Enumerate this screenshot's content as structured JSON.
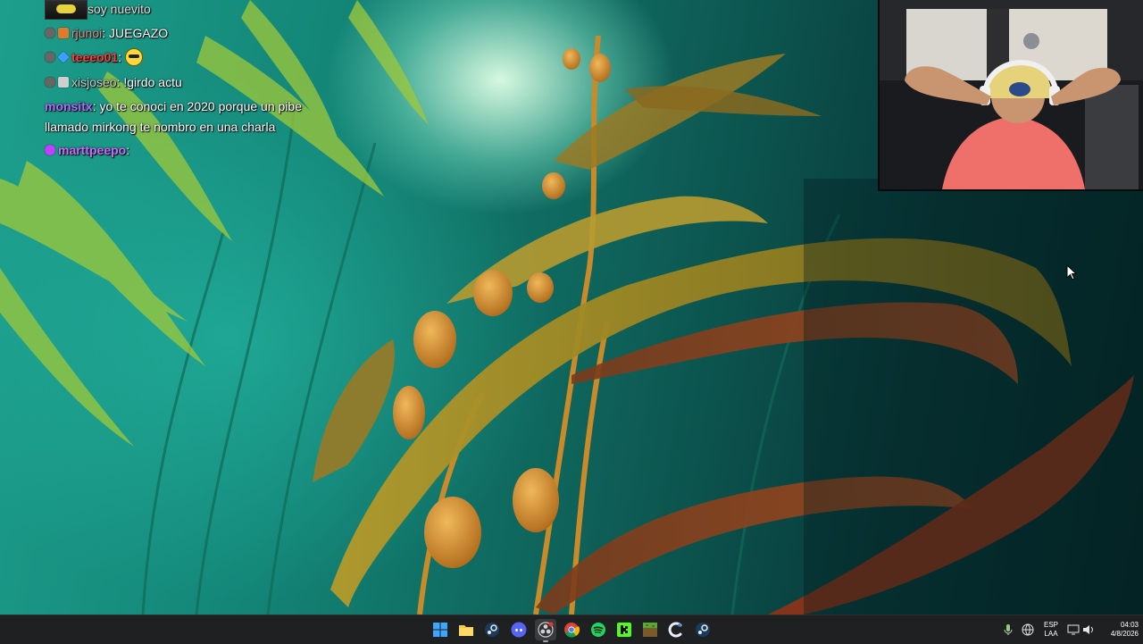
{
  "chat": {
    "messages": [
      {
        "user": "",
        "text": "soy nuevito",
        "user_color": "#dddddd",
        "has_thumbnail": true
      },
      {
        "user": "rjunoi",
        "text": ": JUEGAZO",
        "user_color": "#e08a8a"
      },
      {
        "user": "teeeo01",
        "text": ":",
        "user_color": "#ff3b3b",
        "has_emote": true
      },
      {
        "user": "xisjoseo",
        "text": ": !girdo actu",
        "user_color": "#c9c9c9"
      },
      {
        "user": "monsitx",
        "text": ": yo te conoci en 2020 porque un pibe",
        "user_color": "#b06bff"
      },
      {
        "user": "",
        "text": "llamado mirkong te nombro en una charla",
        "user_color": "#ffffff"
      },
      {
        "user": "marttpeepo",
        "text": ":",
        "user_color": "#c86bff"
      }
    ]
  },
  "taskbar": {
    "apps": [
      {
        "name": "start",
        "label": "Start"
      },
      {
        "name": "file-explorer",
        "label": "File Explorer"
      },
      {
        "name": "steam",
        "label": "Steam"
      },
      {
        "name": "discord",
        "label": "Discord"
      },
      {
        "name": "obs",
        "label": "OBS"
      },
      {
        "name": "chrome",
        "label": "Chrome"
      },
      {
        "name": "spotify",
        "label": "Spotify"
      },
      {
        "name": "kick",
        "label": "Kick"
      },
      {
        "name": "minecraft",
        "label": "Minecraft"
      },
      {
        "name": "ccleaner",
        "label": "CCleaner"
      },
      {
        "name": "steam-2",
        "label": "Steam"
      }
    ],
    "tray": {
      "language_top": "ESP",
      "language_bottom": "LAA",
      "time": "04:03",
      "date": "4/8/2026"
    }
  },
  "colors": {
    "taskbar_bg": "#1f2022",
    "chat_text": "#ffffff"
  }
}
